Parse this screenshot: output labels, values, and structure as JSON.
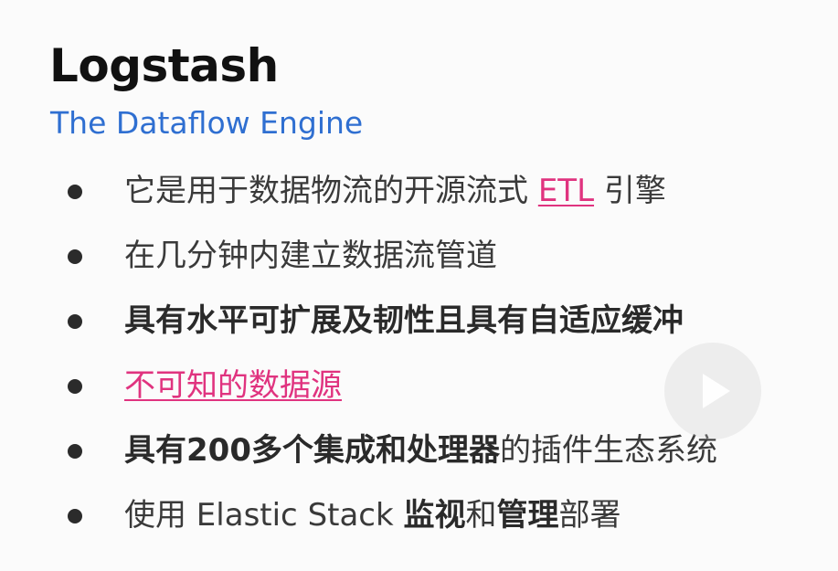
{
  "title": "Logstash",
  "subtitle": "The Dataflow Engine",
  "bullets": {
    "b1": {
      "pre": "它是用于数据物流的开源流式 ",
      "link": "ETL",
      "post": " 引擎"
    },
    "b2": {
      "text": "在几分钟内建立数据流管道"
    },
    "b3": {
      "text": "具有水平可扩展及韧性且具有自适应缓冲"
    },
    "b4": {
      "link": "不可知的数据源"
    },
    "b5": {
      "bold": "具有200多个集成和处理器",
      "post": "的插件生态系统"
    },
    "b6": {
      "pre": "使用 Elastic Stack ",
      "bold1": "监视",
      "mid": "和",
      "bold2": "管理",
      "post": "部署"
    }
  },
  "colors": {
    "accent_link": "#e0337f",
    "subtitle": "#2f6fd1"
  },
  "icons": {
    "play": "play-icon"
  }
}
